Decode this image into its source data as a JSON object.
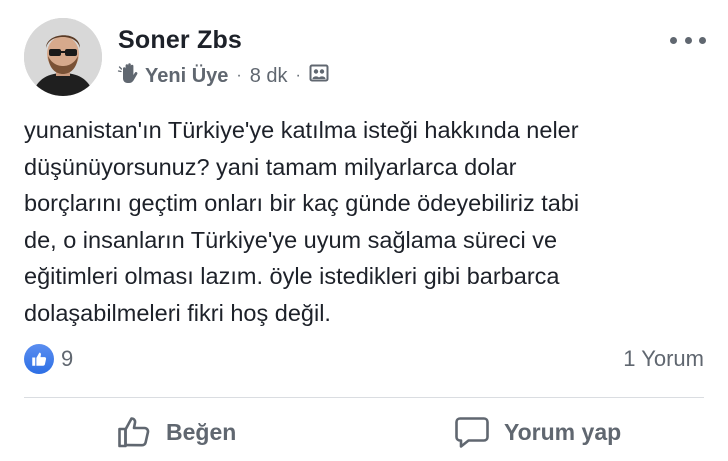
{
  "post": {
    "author": "Soner Zbs",
    "badge_label": "Yeni Üye",
    "separator": "·",
    "time": "8 dk",
    "text_lines": [
      "yunanistan'ın Türkiye'ye katılma isteği hakkında neler",
      "düşünüyorsunuz? yani tamam milyarlarca dolar",
      "borçlarını geçtim onları bir kaç günde ödeyebiliriz tabi",
      "de, o insanların Türkiye'ye uyum sağlama süreci ve",
      "eğitimleri olması lazım. öyle istedikleri gibi barbarca",
      "dolaşabilmeleri fikri hoş değil."
    ],
    "like_count": "9",
    "comment_count_label": "1 Yorum"
  },
  "actions": {
    "like_label": "Beğen",
    "comment_label": "Yorum yap"
  },
  "icons": {
    "more": "more-options-icon",
    "badge": "waving-hand-icon",
    "privacy": "group-audience-icon",
    "like_reaction": "like-reaction-icon",
    "like_action": "thumbs-up-outline-icon",
    "comment_action": "comment-bubble-icon"
  },
  "colors": {
    "like_blue": "#2d6fe5",
    "text": "#1d2129",
    "secondary_text": "#606770",
    "divider": "#dadde1"
  }
}
